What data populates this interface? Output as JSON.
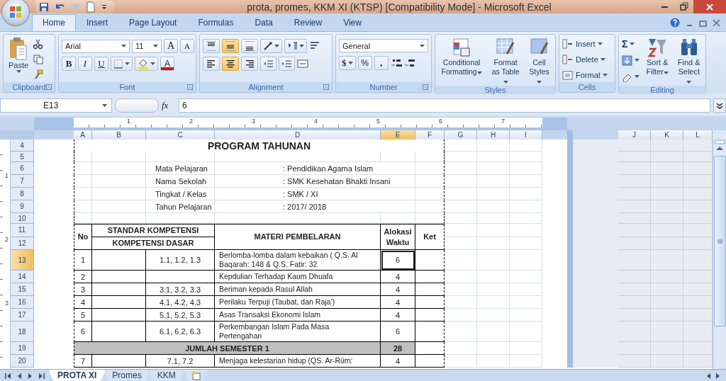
{
  "window": {
    "title": "prota, promes, KKM XI (KTSP)  [Compatibility Mode] - Microsoft Excel"
  },
  "ribbon_tabs": [
    {
      "label": "Home",
      "selected": true
    },
    {
      "label": "Insert",
      "selected": false
    },
    {
      "label": "Page Layout",
      "selected": false
    },
    {
      "label": "Formulas",
      "selected": false
    },
    {
      "label": "Data",
      "selected": false
    },
    {
      "label": "Review",
      "selected": false
    },
    {
      "label": "View",
      "selected": false
    }
  ],
  "ribbon": {
    "clipboard": {
      "label": "Clipboard",
      "paste": "Paste"
    },
    "font": {
      "label": "Font",
      "name": "Arial",
      "size": "11",
      "grow": "A",
      "shrink": "A",
      "bold": "B",
      "italic": "I",
      "underline": "U",
      "font_color_letter": "A"
    },
    "alignment": {
      "label": "Alignment",
      "vertical": [
        {
          "selected": false
        },
        {
          "selected": true
        },
        {
          "selected": false
        }
      ],
      "horizontal": [
        {
          "selected": false
        },
        {
          "selected": true
        },
        {
          "selected": false
        }
      ]
    },
    "number": {
      "label": "Number",
      "format": "General",
      "currency": "$",
      "percent": "%",
      "comma": ","
    },
    "styles": {
      "label": "Styles",
      "buttons": [
        {
          "label": "Conditional Formatting"
        },
        {
          "label": "Format as Table"
        },
        {
          "label": "Cell Styles"
        }
      ]
    },
    "cells": {
      "label": "Cells",
      "buttons": [
        {
          "label": "Insert"
        },
        {
          "label": "Delete"
        },
        {
          "label": "Format"
        }
      ]
    },
    "editing": {
      "label": "Editing",
      "sum": "Σ",
      "buttons": [
        {
          "label": "Sort & Filter"
        },
        {
          "label": "Find & Select"
        }
      ]
    }
  },
  "formula_bar": {
    "name_box": "E13",
    "fx": "fx",
    "value": "6"
  },
  "ruler": {
    "labels": [
      "1",
      "2",
      "3",
      "4",
      "5",
      "6",
      "7"
    ]
  },
  "vertical_ruler": {
    "labels": [
      "1",
      "2",
      "3"
    ]
  },
  "columns": [
    {
      "label": "A",
      "selected": false
    },
    {
      "label": "B",
      "selected": false
    },
    {
      "label": "C",
      "selected": false
    },
    {
      "label": "D",
      "selected": false
    },
    {
      "label": "E",
      "selected": true
    },
    {
      "label": "F",
      "selected": false
    },
    {
      "label": "G",
      "selected": false
    },
    {
      "label": "H",
      "selected": false
    },
    {
      "label": "I",
      "selected": false
    }
  ],
  "right_columns": [
    "J",
    "K",
    "L"
  ],
  "bands": [
    {
      "kind": "title",
      "rows": [
        {
          "label": "4",
          "selected": false
        }
      ],
      "text": "PROGRAM TAHUNAN"
    },
    {
      "kind": "blank",
      "rows": [
        {
          "label": "5",
          "selected": false
        }
      ]
    },
    {
      "kind": "info",
      "rows": [
        {
          "label": "6",
          "selected": false
        }
      ],
      "label": "Mata Pelajaran",
      "value": ": Pendidikan Agama Islam"
    },
    {
      "kind": "info",
      "rows": [
        {
          "label": "7",
          "selected": false
        }
      ],
      "label": "Nama Sekolah",
      "value": ": SMK Kesehatan Bhakti Insani"
    },
    {
      "kind": "info",
      "rows": [
        {
          "label": "8",
          "selected": false
        }
      ],
      "label": "Tingkat / Kelas",
      "value": ": SMK / XI"
    },
    {
      "kind": "info",
      "rows": [
        {
          "label": "9",
          "selected": false
        }
      ],
      "label": "Tahun Pelajaran",
      "value": ": 2017/ 2018"
    },
    {
      "kind": "blank",
      "rows": [
        {
          "label": "10",
          "selected": false
        }
      ]
    },
    {
      "kind": "header",
      "rows": [
        {
          "label": "11",
          "selected": false
        },
        {
          "label": "12",
          "selected": false
        }
      ],
      "no": "No",
      "standard": "STANDAR KOMPETENSI",
      "basic": "KOMPETENSI DASAR",
      "material": "MATERI PEMBELARAN",
      "time": "Alokasi Waktu",
      "note": "Ket"
    },
    {
      "kind": "item",
      "rows": [
        {
          "label": "13",
          "selected": true
        }
      ],
      "no": "1",
      "kd": "1.1, 1.2, 1.3",
      "material": "Berlomba-lomba dalam kebaikan ( Q.S. Al Baqarah: 148 & Q.S. Fatir: 32",
      "time": "6",
      "active": true
    },
    {
      "kind": "item",
      "rows": [
        {
          "label": "14",
          "selected": false
        }
      ],
      "no": "2",
      "material": "Kepdulian Terhadap Kaum Dhuafa",
      "time": "4",
      "active": false
    },
    {
      "kind": "item",
      "rows": [
        {
          "label": "15",
          "selected": false
        }
      ],
      "no": "3",
      "kd": "3.1, 3.2, 3.3",
      "material": "Beriman kepada Rasul Allah",
      "time": "4",
      "active": false
    },
    {
      "kind": "item",
      "rows": [
        {
          "label": "16",
          "selected": false
        }
      ],
      "no": "4",
      "kd": "4.1, 4.2, 4.3",
      "material": "Perilaku Terpuji (Taubat, dan Raja’)",
      "time": "4",
      "active": false
    },
    {
      "kind": "item",
      "rows": [
        {
          "label": "17",
          "selected": false
        }
      ],
      "no": "5",
      "kd": "5.1, 5.2, 5.3",
      "material": "Asas Transaksi Ekonomi Islam",
      "time": "4",
      "active": false
    },
    {
      "kind": "item",
      "rows": [
        {
          "label": "18",
          "selected": false
        }
      ],
      "no": "6",
      "kd": "6.1, 6.2, 6.3",
      "material": "Perkembangan Islam Pada Masa Pertengahan",
      "time": "6",
      "active": false
    },
    {
      "kind": "total",
      "rows": [
        {
          "label": "19",
          "selected": false
        }
      ],
      "label": "JUMLAH SEMESTER 1",
      "value": "28"
    },
    {
      "kind": "item",
      "rows": [
        {
          "label": "20",
          "selected": false
        }
      ],
      "no": "7",
      "kd": "7.1, 7.2",
      "material": "Menjaga kelestarian hidup (QS. Ar-Rūm:",
      "time": "4",
      "active": false
    }
  ],
  "sheet_tabs": [
    {
      "label": "PROTA XI",
      "selected": true
    },
    {
      "label": "Promes",
      "selected": false
    },
    {
      "label": "KKM",
      "selected": false
    }
  ]
}
